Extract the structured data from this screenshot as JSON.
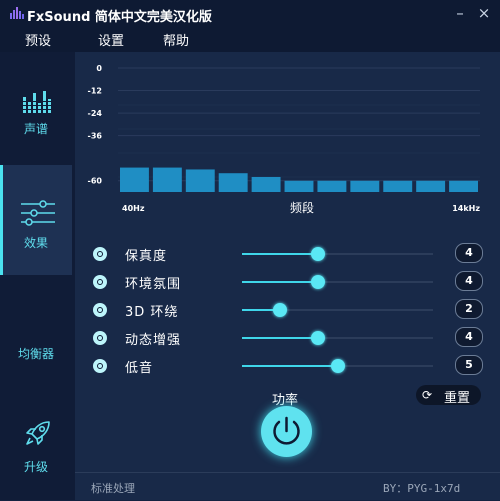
{
  "app": {
    "title": "FxSound 简体中文完美汉化版"
  },
  "window": {
    "minimize_label": "–",
    "close_label": "×"
  },
  "menu": [
    "预设",
    "设置",
    "帮助"
  ],
  "sidebar": {
    "items": [
      {
        "label": "声谱",
        "icon": "spectrum-icon",
        "active": false
      },
      {
        "label": "效果",
        "icon": "sliders-icon",
        "active": true
      },
      {
        "label": "均衡器",
        "icon": "",
        "active": false
      },
      {
        "label": "升级",
        "icon": "rocket-icon",
        "active": false
      }
    ]
  },
  "chart_data": {
    "type": "bar",
    "xlabel": "频段",
    "x_tick_labels": [
      "40Hz",
      "14kHz"
    ],
    "y_ticks": [
      0,
      -12,
      -24,
      -36,
      -60
    ],
    "ylim": [
      -66,
      0
    ],
    "values": [
      -53,
      -53,
      -54,
      -56,
      -58,
      -60,
      -60,
      -60,
      -60,
      -60,
      -60
    ],
    "grid": true,
    "color": "#1f8ec4"
  },
  "effects": [
    {
      "label": "保真度",
      "value": "4"
    },
    {
      "label": "环境氛围",
      "value": "4"
    },
    {
      "label": "3D 环绕",
      "value": "2"
    },
    {
      "label": "动态增强",
      "value": "4"
    },
    {
      "label": "低音",
      "value": "5"
    }
  ],
  "effects_max": 10,
  "reset": {
    "label": "重置",
    "icon": "refresh-icon"
  },
  "power": {
    "label": "功率",
    "icon": "power-icon"
  },
  "status": {
    "left": "标准处理",
    "right": "BY：PYG-1x7d"
  },
  "colors": {
    "accent": "#4be2ef",
    "background": "#182948",
    "sidebar": "#101c37"
  }
}
